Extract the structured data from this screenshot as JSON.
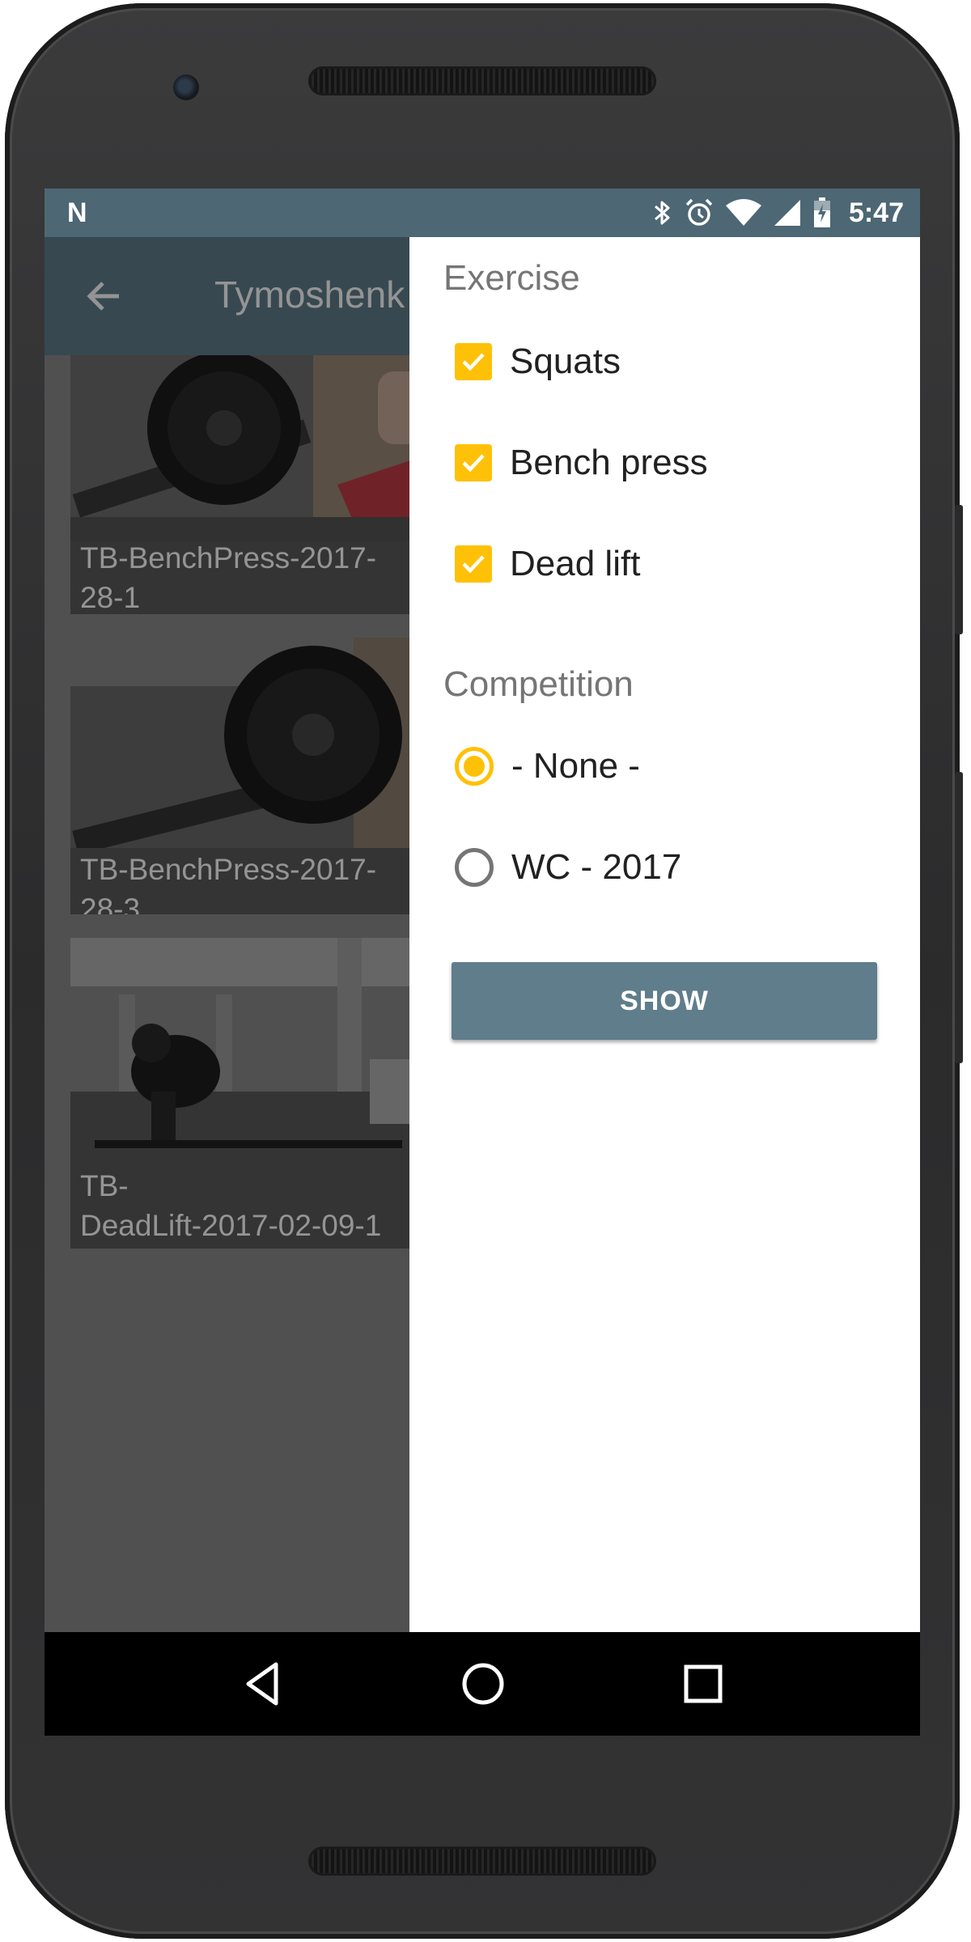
{
  "status_bar": {
    "time": "5:47",
    "icons": [
      "notification-n-icon",
      "bluetooth-icon",
      "alarm-icon",
      "wifi-icon",
      "cell-signal-icon",
      "battery-charging-icon"
    ],
    "notification_glyph": "N"
  },
  "app": {
    "toolbar_title": "Tymoshenk",
    "back_icon": "arrow-back-icon",
    "videos": [
      {
        "label": "TB-BenchPress-2017-\n28-1"
      },
      {
        "label": "TB-BenchPress-2017-\n28-3"
      },
      {
        "label": "TB-\nDeadLift-2017-02-09-1"
      }
    ]
  },
  "filter_drawer": {
    "exercise_title": "Exercise",
    "exercises": [
      {
        "label": "Squats",
        "checked": true
      },
      {
        "label": "Bench press",
        "checked": true
      },
      {
        "label": "Dead lift",
        "checked": true
      }
    ],
    "competition_title": "Competition",
    "competitions": [
      {
        "label": "- None -",
        "selected": true
      },
      {
        "label": "WC - 2017",
        "selected": false
      }
    ],
    "show_button": "SHOW"
  },
  "colors": {
    "status_bar": "#4d6774",
    "toolbar": "#607d8b",
    "accent": "#ffc107",
    "button": "#607d8b",
    "secondary_text": "#757575",
    "primary_text": "#212121"
  },
  "nav_bar": {
    "icons": [
      "nav-back-icon",
      "nav-home-icon",
      "nav-recents-icon"
    ]
  }
}
